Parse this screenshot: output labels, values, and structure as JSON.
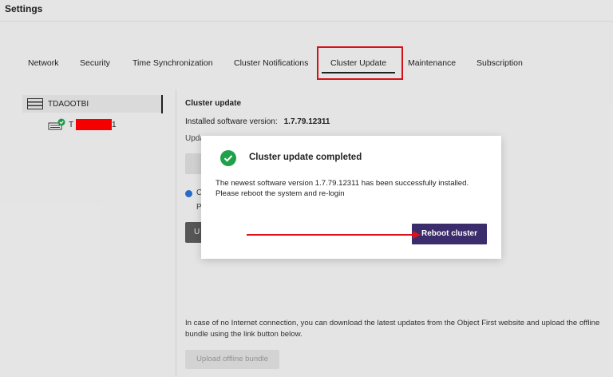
{
  "app": {
    "title": "Settings"
  },
  "tabs": [
    {
      "label": "Network"
    },
    {
      "label": "Security"
    },
    {
      "label": "Time Synchronization"
    },
    {
      "label": "Cluster Notifications"
    },
    {
      "label": "Cluster Update",
      "active": true
    },
    {
      "label": "Maintenance"
    },
    {
      "label": "Subscription"
    }
  ],
  "sidebar": {
    "cluster": {
      "label": "TDAOOTBI",
      "icon": "server-rack-icon"
    },
    "node": {
      "label_prefix": "T",
      "label_suffix": "1",
      "icon": "server-node-ok-icon"
    }
  },
  "content": {
    "heading": "Cluster update",
    "installed_label": "Installed software version:",
    "installed_version": "1.7.79.12311",
    "partial_update": "Upda",
    "partial_info_c": "C",
    "partial_info_p": "P",
    "partial_btn": "U",
    "offline_text": "In case of no Internet connection, you can download the latest updates from the Object First website and upload the offline bundle using the link button below.",
    "offline_button": "Upload offline bundle"
  },
  "modal": {
    "title": "Cluster update completed",
    "message_line1": "The newest software version 1.7.79.12311 has been successfully installed.",
    "message_line2": "Please reboot the system and re-login",
    "reboot_button": "Reboot cluster",
    "icon": "check-circle-icon"
  },
  "colors": {
    "accent": "#3b2c6b",
    "success": "#1fa14a",
    "highlight": "#e0101a",
    "redaction": "#ff0000"
  }
}
